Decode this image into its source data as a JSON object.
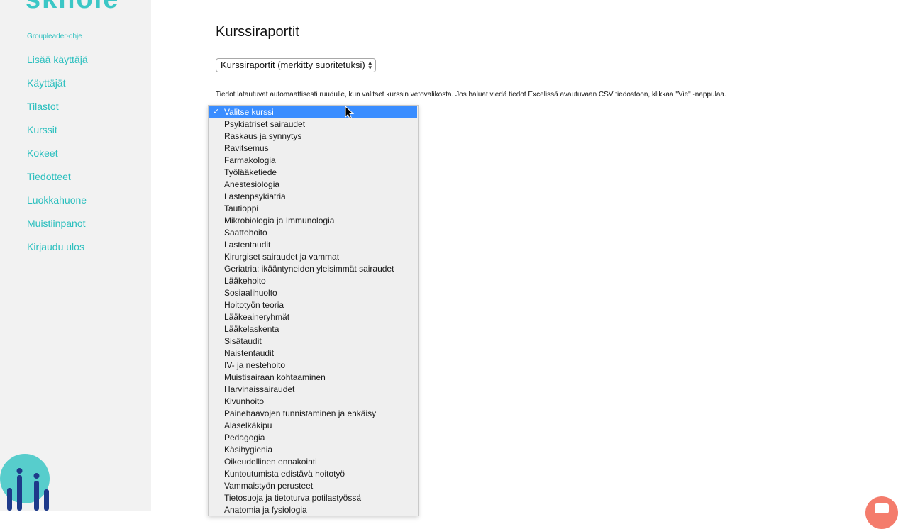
{
  "sidebar": {
    "logo": "skhole",
    "group_link": "Groupleader-ohje",
    "nav": [
      {
        "label": "Lisää käyttäjä"
      },
      {
        "label": "Käyttäjät"
      },
      {
        "label": "Tilastot"
      },
      {
        "label": "Kurssit"
      },
      {
        "label": "Kokeet"
      },
      {
        "label": "Tiedotteet"
      },
      {
        "label": "Luokkahuone"
      },
      {
        "label": "Muistiinpanot"
      },
      {
        "label": "Kirjaudu ulos"
      }
    ]
  },
  "main": {
    "title": "Kurssiraportit",
    "report_select": {
      "value": "Kurssiraportit (merkitty suoritetuksi)"
    },
    "info_text": "Tiedot latautuvat automaattisesti ruudulle, kun valitset kurssin vetovalikosta. Jos haluat viedä tiedot Excelissä avautuvaan CSV tiedostoon, klikkaa \"Vie\" -nappulaa."
  },
  "course_dropdown": {
    "selected_index": 0,
    "options": [
      "Valitse kurssi",
      "Psykiatriset sairaudet",
      "Raskaus ja synnytys",
      "Ravitsemus",
      "Farmakologia",
      "Työlääketiede",
      "Anestesiologia",
      "Lastenpsykiatria",
      "Tautioppi",
      "Mikrobiologia ja Immunologia",
      "Saattohoito",
      "Lastentaudit",
      "Kirurgiset sairaudet ja vammat",
      "Geriatria: ikääntyneiden yleisimmät sairaudet",
      "Lääkehoito",
      "Sosiaalihuolto",
      "Hoitotyön teoria",
      "Lääkeaineryhmät",
      "Lääkelaskenta",
      "Sisätaudit",
      "Naistentaudit",
      "IV- ja nestehoito",
      "Muistisairaan kohtaaminen",
      "Harvinaissairaudet",
      "Kivunhoito",
      "Painehaavojen tunnistaminen ja ehkäisy",
      "Alaselkäkipu",
      "Pedagogia",
      "Käsihygienia",
      "Oikeudellinen ennakointi",
      "Kuntoutumista edistävä hoitotyö",
      "Vammaistyön perusteet",
      "Tietosuoja ja tietoturva potilastyössä",
      "Anatomia ja fysiologia"
    ]
  },
  "colors": {
    "brand": "#2abfbe",
    "selection": "#3a8dff",
    "chat": "#f47c6c",
    "sidebar_bg": "#f2f2f2"
  },
  "icons": {
    "cursor": "mouse-pointer-icon",
    "chat": "chat-icon"
  }
}
